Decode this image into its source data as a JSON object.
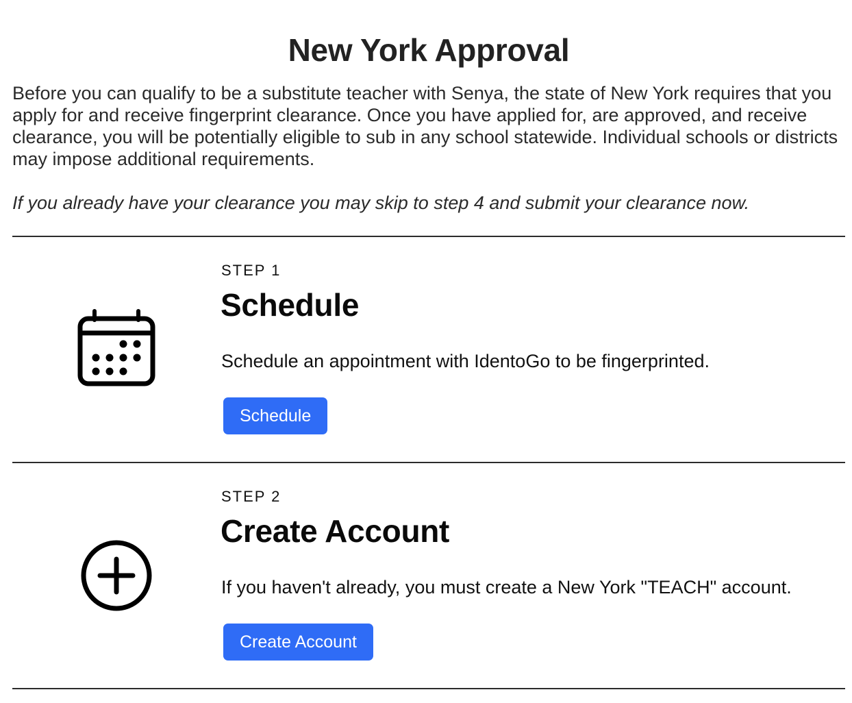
{
  "page": {
    "title": "New York Approval",
    "intro": "Before you can qualify to be a substitute teacher with Senya, the state of New York requires that you apply for and receive fingerprint clearance. Once you have applied for, are approved, and receive clearance, you will be potentially eligible to sub in any school statewide. Individual schools or districts may impose additional requirements.",
    "note": "If you already have your clearance you may skip to step 4 and submit your clearance now."
  },
  "steps": [
    {
      "kicker": "STEP 1",
      "heading": "Schedule",
      "description": "Schedule an appointment with IdentoGo to be fingerprinted.",
      "button_label": "Schedule",
      "icon": "calendar-icon"
    },
    {
      "kicker": "STEP 2",
      "heading": "Create Account",
      "description": "If you haven't already, you must create a New York \"TEACH\" account.",
      "button_label": "Create Account",
      "icon": "plus-circle-icon"
    }
  ],
  "colors": {
    "button": "#2f6cf6",
    "divider": "#2b2b2b",
    "text": "#111111"
  }
}
